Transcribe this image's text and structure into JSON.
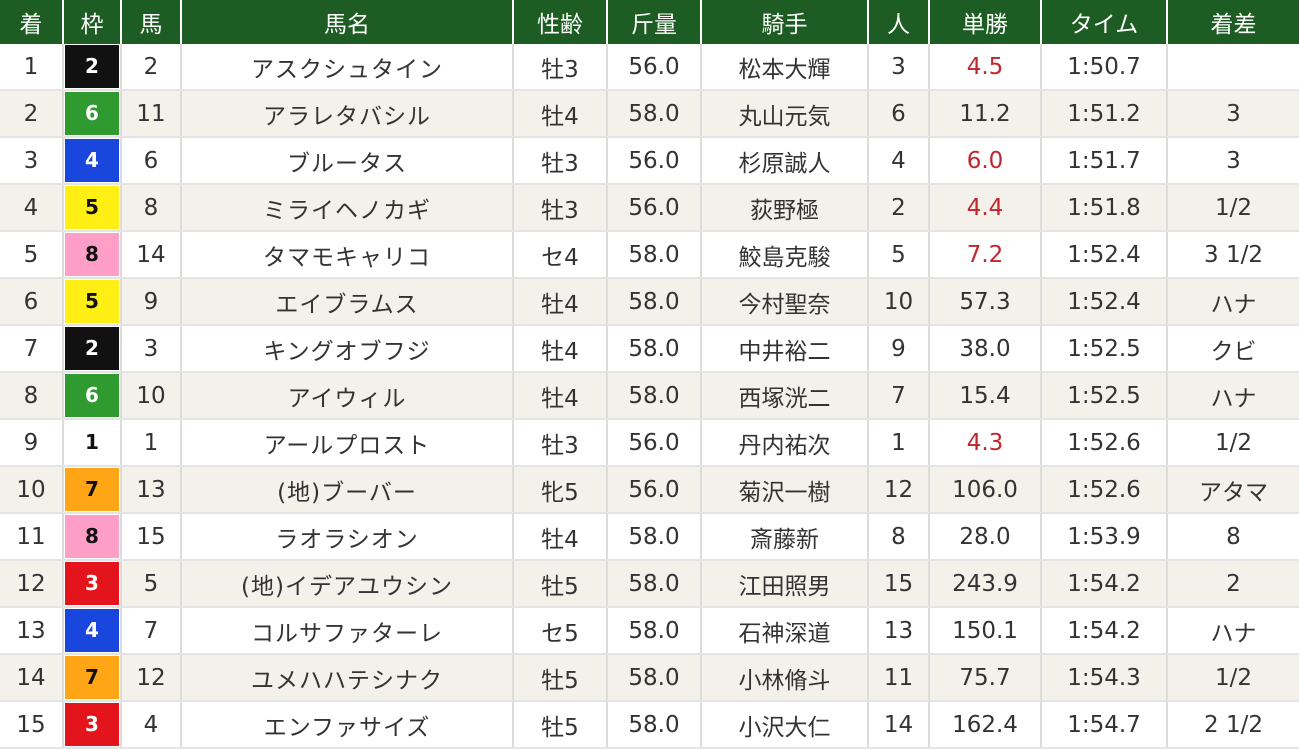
{
  "table": {
    "headers": {
      "rank": "着",
      "waku": "枠",
      "num": "馬",
      "name": "馬名",
      "sexage": "性齢",
      "weight": "斤量",
      "jockey": "騎手",
      "pop": "人",
      "odds": "単勝",
      "time": "タイム",
      "margin": "着差"
    },
    "rows": [
      {
        "rank": "1",
        "waku": "2",
        "num": "2",
        "name": "アスクシュタイン",
        "sexage": "牡3",
        "weight": "56.0",
        "jockey": "松本大輝",
        "pop": "3",
        "odds": "4.5",
        "time": "1:50.7",
        "margin": ""
      },
      {
        "rank": "2",
        "waku": "6",
        "num": "11",
        "name": "アラレタバシル",
        "sexage": "牡4",
        "weight": "58.0",
        "jockey": "丸山元気",
        "pop": "6",
        "odds": "11.2",
        "time": "1:51.2",
        "margin": "3"
      },
      {
        "rank": "3",
        "waku": "4",
        "num": "6",
        "name": "ブルータス",
        "sexage": "牡3",
        "weight": "56.0",
        "jockey": "杉原誠人",
        "pop": "4",
        "odds": "6.0",
        "time": "1:51.7",
        "margin": "3"
      },
      {
        "rank": "4",
        "waku": "5",
        "num": "8",
        "name": "ミライヘノカギ",
        "sexage": "牡3",
        "weight": "56.0",
        "jockey": "荻野極",
        "pop": "2",
        "odds": "4.4",
        "time": "1:51.8",
        "margin": "1/2"
      },
      {
        "rank": "5",
        "waku": "8",
        "num": "14",
        "name": "タマモキャリコ",
        "sexage": "セ4",
        "weight": "58.0",
        "jockey": "鮫島克駿",
        "pop": "5",
        "odds": "7.2",
        "time": "1:52.4",
        "margin": "3 1/2"
      },
      {
        "rank": "6",
        "waku": "5",
        "num": "9",
        "name": "エイブラムス",
        "sexage": "牡4",
        "weight": "58.0",
        "jockey": "今村聖奈",
        "pop": "10",
        "odds": "57.3",
        "time": "1:52.4",
        "margin": "ハナ"
      },
      {
        "rank": "7",
        "waku": "2",
        "num": "3",
        "name": "キングオブフジ",
        "sexage": "牡4",
        "weight": "58.0",
        "jockey": "中井裕二",
        "pop": "9",
        "odds": "38.0",
        "time": "1:52.5",
        "margin": "クビ"
      },
      {
        "rank": "8",
        "waku": "6",
        "num": "10",
        "name": "アイウィル",
        "sexage": "牡4",
        "weight": "58.0",
        "jockey": "西塚洸二",
        "pop": "7",
        "odds": "15.4",
        "time": "1:52.5",
        "margin": "ハナ"
      },
      {
        "rank": "9",
        "waku": "1",
        "num": "1",
        "name": "アールプロスト",
        "sexage": "牡3",
        "weight": "56.0",
        "jockey": "丹内祐次",
        "pop": "1",
        "odds": "4.3",
        "time": "1:52.6",
        "margin": "1/2"
      },
      {
        "rank": "10",
        "waku": "7",
        "num": "13",
        "name": "(地)ブーバー",
        "sexage": "牝5",
        "weight": "56.0",
        "jockey": "菊沢一樹",
        "pop": "12",
        "odds": "106.0",
        "time": "1:52.6",
        "margin": "アタマ"
      },
      {
        "rank": "11",
        "waku": "8",
        "num": "15",
        "name": "ラオラシオン",
        "sexage": "牡4",
        "weight": "58.0",
        "jockey": "斎藤新",
        "pop": "8",
        "odds": "28.0",
        "time": "1:53.9",
        "margin": "8"
      },
      {
        "rank": "12",
        "waku": "3",
        "num": "5",
        "name": "(地)イデアユウシン",
        "sexage": "牡5",
        "weight": "58.0",
        "jockey": "江田照男",
        "pop": "15",
        "odds": "243.9",
        "time": "1:54.2",
        "margin": "2"
      },
      {
        "rank": "13",
        "waku": "4",
        "num": "7",
        "name": "コルサファターレ",
        "sexage": "セ5",
        "weight": "58.0",
        "jockey": "石神深道",
        "pop": "13",
        "odds": "150.1",
        "time": "1:54.2",
        "margin": "ハナ"
      },
      {
        "rank": "14",
        "waku": "7",
        "num": "12",
        "name": "ユメハハテシナク",
        "sexage": "牡5",
        "weight": "58.0",
        "jockey": "小林脩斗",
        "pop": "11",
        "odds": "75.7",
        "time": "1:54.3",
        "margin": "1/2"
      },
      {
        "rank": "15",
        "waku": "3",
        "num": "4",
        "name": "エンファサイズ",
        "sexage": "牡5",
        "weight": "58.0",
        "jockey": "小沢大仁",
        "pop": "14",
        "odds": "162.4",
        "time": "1:54.7",
        "margin": "2 1/2"
      }
    ]
  },
  "colors": {
    "header_bg": "#1d5c22",
    "favorite_odds": "#c0262d",
    "link_text": "#1f4fa0",
    "waku": {
      "1": {
        "bg": "#ffffff",
        "fg": "#111111"
      },
      "2": {
        "bg": "#111111",
        "fg": "#ffffff"
      },
      "3": {
        "bg": "#e3141b",
        "fg": "#ffffff"
      },
      "4": {
        "bg": "#1947de",
        "fg": "#ffffff"
      },
      "5": {
        "bg": "#ffef14",
        "fg": "#111111"
      },
      "6": {
        "bg": "#2f9a2f",
        "fg": "#ffffff"
      },
      "7": {
        "bg": "#ffa516",
        "fg": "#111111"
      },
      "8": {
        "bg": "#ff9fc7",
        "fg": "#111111"
      }
    }
  }
}
